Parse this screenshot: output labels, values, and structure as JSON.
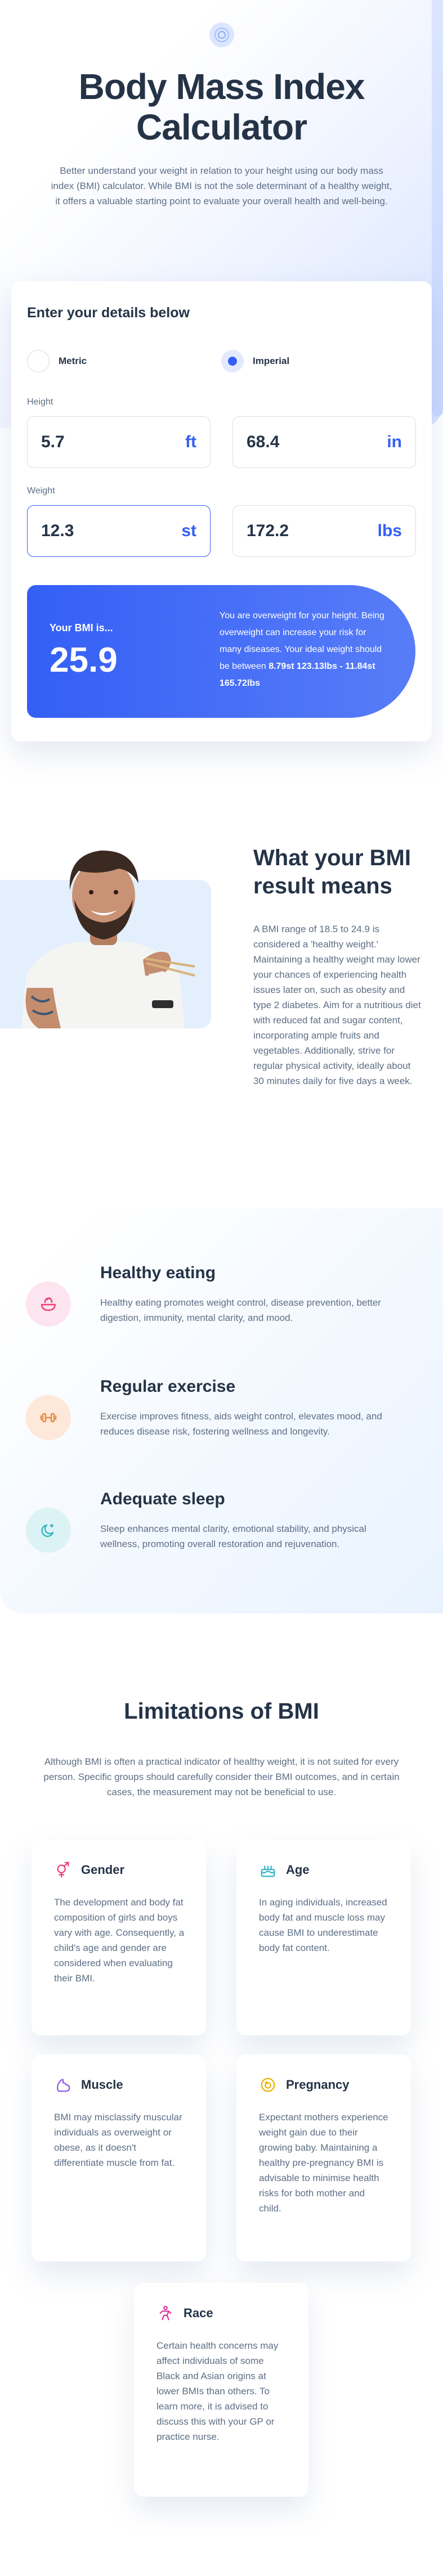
{
  "hero": {
    "title": "Body Mass Index Calculator",
    "description": "Better understand your weight in relation to your height using our body mass index (BMI) calculator. While BMI is not the sole determinant of a healthy weight, it offers a valuable starting point to evaluate your overall health and well-being."
  },
  "calculator": {
    "heading": "Enter your details below",
    "units": {
      "metric": "Metric",
      "imperial": "Imperial",
      "selected": "Imperial"
    },
    "height": {
      "label": "Height",
      "ft_value": "5.7",
      "ft_unit": "ft",
      "in_value": "68.4",
      "in_unit": "in"
    },
    "weight": {
      "label": "Weight",
      "st_value": "12.3",
      "st_unit": "st",
      "lbs_value": "172.2",
      "lbs_unit": "lbs"
    },
    "result": {
      "label": "Your BMI is...",
      "value": "25.9",
      "message": "You are overweight for your height. Being overweight can increase your risk for many diseases. Your ideal weight should be between",
      "ideal_range": "8.79st 123.13lbs - 11.84st 165.72lbs"
    }
  },
  "meaning": {
    "title": "What your BMI result means",
    "text": "A BMI range of 18.5 to 24.9 is considered a 'healthy weight.' Maintaining a healthy weight may lower your chances of experiencing health issues later on, such as obesity and type 2 diabetes. Aim for a nutritious diet with reduced fat and sugar content, incorporating ample fruits and vegetables. Additionally, strive for regular physical activity, ideally about 30 minutes daily for five days a week."
  },
  "tips": [
    {
      "icon": "bowl-icon",
      "title": "Healthy eating",
      "text": "Healthy eating promotes weight control, disease prevention, better digestion, immunity, mental clarity, and mood.",
      "color": "#f13d77"
    },
    {
      "icon": "dumbbell-icon",
      "title": "Regular exercise",
      "text": "Exercise improves fitness, aids weight control, elevates mood, and reduces disease risk, fostering wellness and longevity.",
      "color": "#e7893f"
    },
    {
      "icon": "moon-icon",
      "title": "Adequate sleep",
      "text": "Sleep enhances mental clarity, emotional stability, and physical wellness, promoting overall restoration and rejuvenation.",
      "color": "#32b5c4"
    }
  ],
  "limitations": {
    "title": "Limitations of BMI",
    "description": "Although BMI is often a practical indicator of healthy weight, it is not suited for every person. Specific groups should carefully consider their BMI outcomes, and in certain cases, the measurement may not be beneficial to use.",
    "items": [
      {
        "icon": "gender-icon",
        "label": "Gender",
        "text": "The development and body fat composition of girls and boys vary with age. Consequently, a child's age and gender are considered when evaluating their BMI.",
        "color": "#f13d77"
      },
      {
        "icon": "age-cake-icon",
        "label": "Age",
        "text": "In aging individuals, increased body fat and muscle loss may cause BMI to underestimate body fat content.",
        "color": "#32b5c4"
      },
      {
        "icon": "muscle-icon",
        "label": "Muscle",
        "text": "BMI may misclassify muscular individuals as overweight or obese, as it doesn't differentiate muscle from fat.",
        "color": "#8e5ae6"
      },
      {
        "icon": "pregnancy-icon",
        "label": "Pregnancy",
        "text": "Expectant mothers experience weight gain due to their growing baby. Maintaining a healthy pre-pregnancy BMI is advisable to minimise health risks for both mother and child.",
        "color": "#e9b300"
      },
      {
        "icon": "race-icon",
        "label": "Race",
        "text": "Certain health concerns may affect individuals of some Black and Asian origins at lower BMIs than others. To learn more, it is advised to discuss this with your GP or practice nurse.",
        "color": "#e0379d"
      }
    ]
  }
}
